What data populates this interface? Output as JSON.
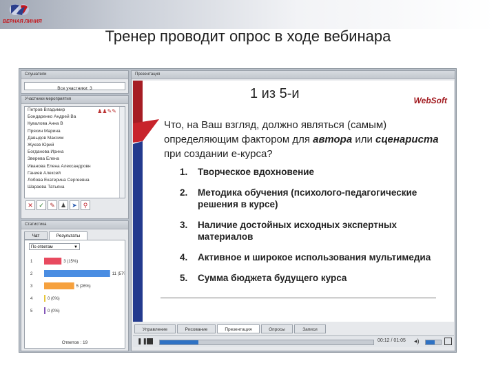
{
  "logo": {
    "text": "ВЕРНАЯ ЛИНИЯ"
  },
  "slide_title": "Тренер проводит опрос в ходе вебинара",
  "listeners": {
    "title": "Слушатели",
    "count_label": "Все участники: 3",
    "participants_title": "Участники мероприятия",
    "names": [
      "Петров Владимир",
      "Бондаренко Андрей Ва",
      "Кувалова Анна В",
      "Пряхин Марина",
      "Давыдов Максим",
      "Жуков Юрий",
      "Богданова Ирина",
      "Зверева Елена",
      "Иванова Елена Александровн",
      "Ганиев Алексей",
      "Лобова Екатерина Сергеевна",
      "Шараева Татьяна"
    ],
    "toolbar_icons": [
      "close-icon",
      "check-icon",
      "pen-icon",
      "person-icon",
      "arrow-icon",
      "pin-icon"
    ]
  },
  "poll": {
    "title": "Статистика",
    "tabs": [
      "Чат",
      "Результаты"
    ],
    "select_value": "По ответам",
    "bars": [
      {
        "num": "1",
        "label": "3 (15%)",
        "value": 15,
        "color": "#e84a5f"
      },
      {
        "num": "2",
        "label": "11 (57%)",
        "value": 57,
        "color": "#4a8de2"
      },
      {
        "num": "3",
        "label": "5 (26%)",
        "value": 26,
        "color": "#f6a13e"
      },
      {
        "num": "4",
        "label": "0 (0%)",
        "value": 0,
        "color": "#e7c63a"
      },
      {
        "num": "5",
        "label": "0 (0%)",
        "value": 0,
        "color": "#8456b8"
      }
    ],
    "footer": "Ответов : 19"
  },
  "presentation": {
    "title": "Презентация",
    "counter": "1 из 5-и",
    "brand": "WebSoft",
    "question": [
      {
        "t": "Что, на Ваш взгляд, должно являться (самым) определяющим фактором для ",
        "b": false
      },
      {
        "t": "автора",
        "b": true
      },
      {
        "t": " или ",
        "b": false
      },
      {
        "t": "сценариста",
        "b": true
      },
      {
        "t": " при создании е-курса?",
        "b": false
      }
    ],
    "options": [
      {
        "n": "1.",
        "text": "Творческое вдохновение"
      },
      {
        "n": "2.",
        "text": "Методика обучения (психолого-педагогические решения в курсе)"
      },
      {
        "n": "3.",
        "text": "Наличие достойных исходных экспертных материалов"
      },
      {
        "n": "4.",
        "text": "Активное и широкое использования мультимедиа"
      },
      {
        "n": "5.",
        "text": "Сумма бюджета будущего курса"
      }
    ],
    "tabs": [
      "Управление",
      "Рисование",
      "Презентация",
      "Опросы",
      "Записи"
    ],
    "active_tab": 2,
    "time": "00:12 / 01:05",
    "progress": 0.18
  }
}
